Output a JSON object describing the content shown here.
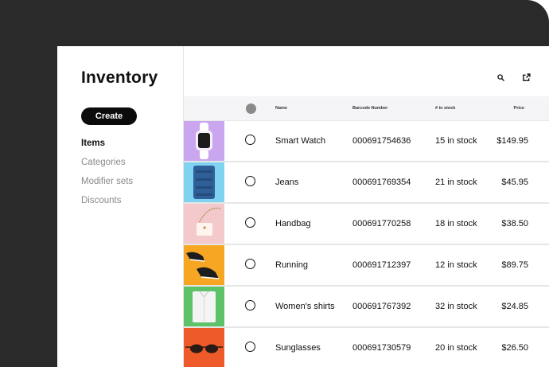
{
  "app": {
    "title": "Inventory"
  },
  "sidebar": {
    "create_label": "Create",
    "items": [
      {
        "label": "Items",
        "active": true
      },
      {
        "label": "Categories",
        "active": false
      },
      {
        "label": "Modifier sets",
        "active": false
      },
      {
        "label": "Discounts",
        "active": false
      }
    ]
  },
  "toolbar": {
    "icons": [
      "search-icon",
      "export-icon"
    ]
  },
  "table": {
    "headers": {
      "name": "Name",
      "barcode": "Barcode Number",
      "stock": "# in stock",
      "price": "Price"
    },
    "rows": [
      {
        "name": "Smart Watch",
        "barcode": "000691754636",
        "stock": "15 in stock",
        "price": "$149.95",
        "thumb_bg": "#c9a6ee"
      },
      {
        "name": "Jeans",
        "barcode": "000691769354",
        "stock": "21 in stock",
        "price": "$45.95",
        "thumb_bg": "#7fd3f0"
      },
      {
        "name": "Handbag",
        "barcode": "000691770258",
        "stock": "18 in stock",
        "price": "$38.50",
        "thumb_bg": "#f3c9cc"
      },
      {
        "name": "Running",
        "barcode": "000691712397",
        "stock": "12 in stock",
        "price": "$89.75",
        "thumb_bg": "#f6a623"
      },
      {
        "name": "Women's shirts",
        "barcode": "000691767392",
        "stock": "32 in stock",
        "price": "$24.85",
        "thumb_bg": "#5dc268"
      },
      {
        "name": "Sunglasses",
        "barcode": "000691730579",
        "stock": "20 in stock",
        "price": "$26.50",
        "thumb_bg": "#ef5a2a"
      }
    ]
  }
}
